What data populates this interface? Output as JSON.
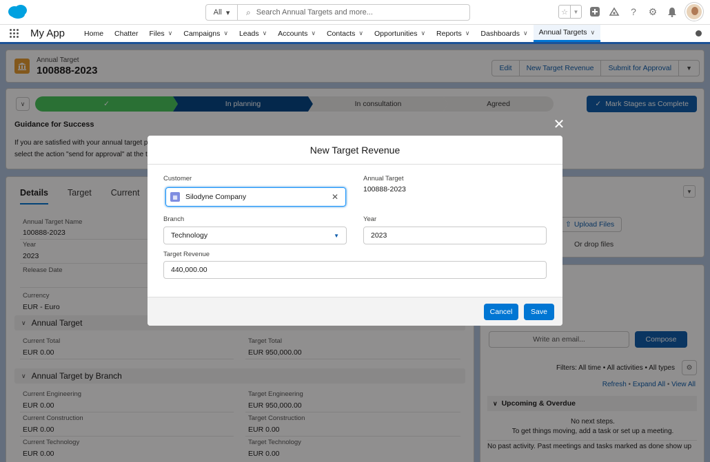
{
  "search": {
    "scope": "All",
    "placeholder": "Search Annual Targets and more..."
  },
  "app": {
    "name": "My App",
    "nav": [
      {
        "label": "Home",
        "chevron": false
      },
      {
        "label": "Chatter",
        "chevron": false
      },
      {
        "label": "Files",
        "chevron": true
      },
      {
        "label": "Campaigns",
        "chevron": true
      },
      {
        "label": "Leads",
        "chevron": true
      },
      {
        "label": "Accounts",
        "chevron": true
      },
      {
        "label": "Contacts",
        "chevron": true
      },
      {
        "label": "Opportunities",
        "chevron": true
      },
      {
        "label": "Reports",
        "chevron": true
      },
      {
        "label": "Dashboards",
        "chevron": true
      },
      {
        "label": "Annual Targets",
        "chevron": true,
        "active": true
      }
    ]
  },
  "record": {
    "type": "Annual Target",
    "name": "100888-2023",
    "actions": [
      "Edit",
      "New Target Revenue",
      "Submit for Approval",
      "▼"
    ]
  },
  "path": {
    "stages": [
      {
        "label": "✓",
        "state": "complete"
      },
      {
        "label": "In planning",
        "state": "current"
      },
      {
        "label": "In consultation",
        "state": "upcoming"
      },
      {
        "label": "Agreed",
        "state": "upcoming"
      }
    ],
    "mark_button": "Mark Stages as Complete",
    "guidance_title": "Guidance for Success",
    "guidance_line1": "If you are satisfied with your annual target pl",
    "guidance_line2": "select the action \"send for approval\" at the t"
  },
  "details": {
    "tabs": [
      "Details",
      "Target",
      "Current"
    ],
    "annual_target_name_label": "Annual Target Name",
    "annual_target_name": "100888-2023",
    "year_label": "Year",
    "year": "2023",
    "release_date_label": "Release Date",
    "currency_label": "Currency",
    "currency": "EUR - Euro",
    "section_annual_target": "Annual Target",
    "current_total_label": "Current Total",
    "current_total": "EUR 0.00",
    "target_total_label": "Target Total",
    "target_total": "EUR 950,000.00",
    "section_by_branch": "Annual Target by Branch",
    "current_engineering_label": "Current Engineering",
    "current_engineering": "EUR 0.00",
    "target_engineering_label": "Target Engineering",
    "target_engineering": "EUR 950,000.00",
    "current_construction_label": "Current Construction",
    "current_construction": "EUR 0.00",
    "target_construction_label": "Target Construction",
    "target_construction": "EUR 0.00",
    "current_technology_label": "Current Technology",
    "current_technology": "EUR 0.00",
    "target_technology_label": "Target Technology",
    "target_technology": "EUR 0.00"
  },
  "files": {
    "upload": "Upload Files",
    "drop": "Or drop files"
  },
  "activity": {
    "email_placeholder": "Write an email...",
    "compose": "Compose",
    "filters": "Filters: All time • All activities • All types",
    "refresh": "Refresh",
    "expand": "Expand All",
    "view": "View All",
    "upcoming": "Upcoming & Overdue",
    "no_steps": "No next steps.",
    "no_steps_hint": "To get things moving, add a task or set up a meeting.",
    "no_past": "No past activity. Past meetings and tasks marked as done show up"
  },
  "modal": {
    "title": "New Target Revenue",
    "customer_label": "Customer",
    "customer_value": "Silodyne Company",
    "annual_target_label": "Annual Target",
    "annual_target_value": "100888-2023",
    "branch_label": "Branch",
    "branch_value": "Technology",
    "year_label": "Year",
    "year_value": "2023",
    "revenue_label": "Target Revenue",
    "revenue_value": "440,000.00",
    "cancel": "Cancel",
    "save": "Save"
  },
  "colors": {
    "brand": "#0176d3",
    "stage_complete": "#45c65a",
    "stage_current": "#014486",
    "stage_upcoming": "#ecebea",
    "record_icon": "#e89b2f"
  }
}
